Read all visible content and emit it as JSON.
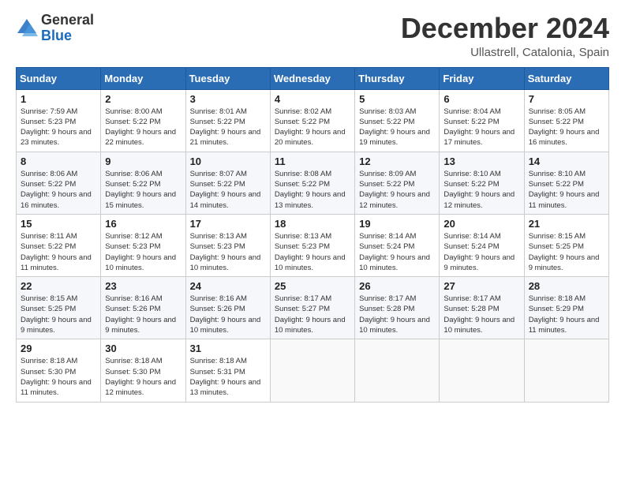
{
  "logo": {
    "general": "General",
    "blue": "Blue"
  },
  "header": {
    "month": "December 2024",
    "location": "Ullastrell, Catalonia, Spain"
  },
  "days": [
    "Sunday",
    "Monday",
    "Tuesday",
    "Wednesday",
    "Thursday",
    "Friday",
    "Saturday"
  ],
  "weeks": [
    [
      {
        "day": "1",
        "sunrise": "Sunrise: 7:59 AM",
        "sunset": "Sunset: 5:23 PM",
        "daylight": "Daylight: 9 hours and 23 minutes."
      },
      {
        "day": "2",
        "sunrise": "Sunrise: 8:00 AM",
        "sunset": "Sunset: 5:22 PM",
        "daylight": "Daylight: 9 hours and 22 minutes."
      },
      {
        "day": "3",
        "sunrise": "Sunrise: 8:01 AM",
        "sunset": "Sunset: 5:22 PM",
        "daylight": "Daylight: 9 hours and 21 minutes."
      },
      {
        "day": "4",
        "sunrise": "Sunrise: 8:02 AM",
        "sunset": "Sunset: 5:22 PM",
        "daylight": "Daylight: 9 hours and 20 minutes."
      },
      {
        "day": "5",
        "sunrise": "Sunrise: 8:03 AM",
        "sunset": "Sunset: 5:22 PM",
        "daylight": "Daylight: 9 hours and 19 minutes."
      },
      {
        "day": "6",
        "sunrise": "Sunrise: 8:04 AM",
        "sunset": "Sunset: 5:22 PM",
        "daylight": "Daylight: 9 hours and 17 minutes."
      },
      {
        "day": "7",
        "sunrise": "Sunrise: 8:05 AM",
        "sunset": "Sunset: 5:22 PM",
        "daylight": "Daylight: 9 hours and 16 minutes."
      }
    ],
    [
      {
        "day": "8",
        "sunrise": "Sunrise: 8:06 AM",
        "sunset": "Sunset: 5:22 PM",
        "daylight": "Daylight: 9 hours and 16 minutes."
      },
      {
        "day": "9",
        "sunrise": "Sunrise: 8:06 AM",
        "sunset": "Sunset: 5:22 PM",
        "daylight": "Daylight: 9 hours and 15 minutes."
      },
      {
        "day": "10",
        "sunrise": "Sunrise: 8:07 AM",
        "sunset": "Sunset: 5:22 PM",
        "daylight": "Daylight: 9 hours and 14 minutes."
      },
      {
        "day": "11",
        "sunrise": "Sunrise: 8:08 AM",
        "sunset": "Sunset: 5:22 PM",
        "daylight": "Daylight: 9 hours and 13 minutes."
      },
      {
        "day": "12",
        "sunrise": "Sunrise: 8:09 AM",
        "sunset": "Sunset: 5:22 PM",
        "daylight": "Daylight: 9 hours and 12 minutes."
      },
      {
        "day": "13",
        "sunrise": "Sunrise: 8:10 AM",
        "sunset": "Sunset: 5:22 PM",
        "daylight": "Daylight: 9 hours and 12 minutes."
      },
      {
        "day": "14",
        "sunrise": "Sunrise: 8:10 AM",
        "sunset": "Sunset: 5:22 PM",
        "daylight": "Daylight: 9 hours and 11 minutes."
      }
    ],
    [
      {
        "day": "15",
        "sunrise": "Sunrise: 8:11 AM",
        "sunset": "Sunset: 5:22 PM",
        "daylight": "Daylight: 9 hours and 11 minutes."
      },
      {
        "day": "16",
        "sunrise": "Sunrise: 8:12 AM",
        "sunset": "Sunset: 5:23 PM",
        "daylight": "Daylight: 9 hours and 10 minutes."
      },
      {
        "day": "17",
        "sunrise": "Sunrise: 8:13 AM",
        "sunset": "Sunset: 5:23 PM",
        "daylight": "Daylight: 9 hours and 10 minutes."
      },
      {
        "day": "18",
        "sunrise": "Sunrise: 8:13 AM",
        "sunset": "Sunset: 5:23 PM",
        "daylight": "Daylight: 9 hours and 10 minutes."
      },
      {
        "day": "19",
        "sunrise": "Sunrise: 8:14 AM",
        "sunset": "Sunset: 5:24 PM",
        "daylight": "Daylight: 9 hours and 10 minutes."
      },
      {
        "day": "20",
        "sunrise": "Sunrise: 8:14 AM",
        "sunset": "Sunset: 5:24 PM",
        "daylight": "Daylight: 9 hours and 9 minutes."
      },
      {
        "day": "21",
        "sunrise": "Sunrise: 8:15 AM",
        "sunset": "Sunset: 5:25 PM",
        "daylight": "Daylight: 9 hours and 9 minutes."
      }
    ],
    [
      {
        "day": "22",
        "sunrise": "Sunrise: 8:15 AM",
        "sunset": "Sunset: 5:25 PM",
        "daylight": "Daylight: 9 hours and 9 minutes."
      },
      {
        "day": "23",
        "sunrise": "Sunrise: 8:16 AM",
        "sunset": "Sunset: 5:26 PM",
        "daylight": "Daylight: 9 hours and 9 minutes."
      },
      {
        "day": "24",
        "sunrise": "Sunrise: 8:16 AM",
        "sunset": "Sunset: 5:26 PM",
        "daylight": "Daylight: 9 hours and 10 minutes."
      },
      {
        "day": "25",
        "sunrise": "Sunrise: 8:17 AM",
        "sunset": "Sunset: 5:27 PM",
        "daylight": "Daylight: 9 hours and 10 minutes."
      },
      {
        "day": "26",
        "sunrise": "Sunrise: 8:17 AM",
        "sunset": "Sunset: 5:28 PM",
        "daylight": "Daylight: 9 hours and 10 minutes."
      },
      {
        "day": "27",
        "sunrise": "Sunrise: 8:17 AM",
        "sunset": "Sunset: 5:28 PM",
        "daylight": "Daylight: 9 hours and 10 minutes."
      },
      {
        "day": "28",
        "sunrise": "Sunrise: 8:18 AM",
        "sunset": "Sunset: 5:29 PM",
        "daylight": "Daylight: 9 hours and 11 minutes."
      }
    ],
    [
      {
        "day": "29",
        "sunrise": "Sunrise: 8:18 AM",
        "sunset": "Sunset: 5:30 PM",
        "daylight": "Daylight: 9 hours and 11 minutes."
      },
      {
        "day": "30",
        "sunrise": "Sunrise: 8:18 AM",
        "sunset": "Sunset: 5:30 PM",
        "daylight": "Daylight: 9 hours and 12 minutes."
      },
      {
        "day": "31",
        "sunrise": "Sunrise: 8:18 AM",
        "sunset": "Sunset: 5:31 PM",
        "daylight": "Daylight: 9 hours and 13 minutes."
      },
      null,
      null,
      null,
      null
    ]
  ]
}
